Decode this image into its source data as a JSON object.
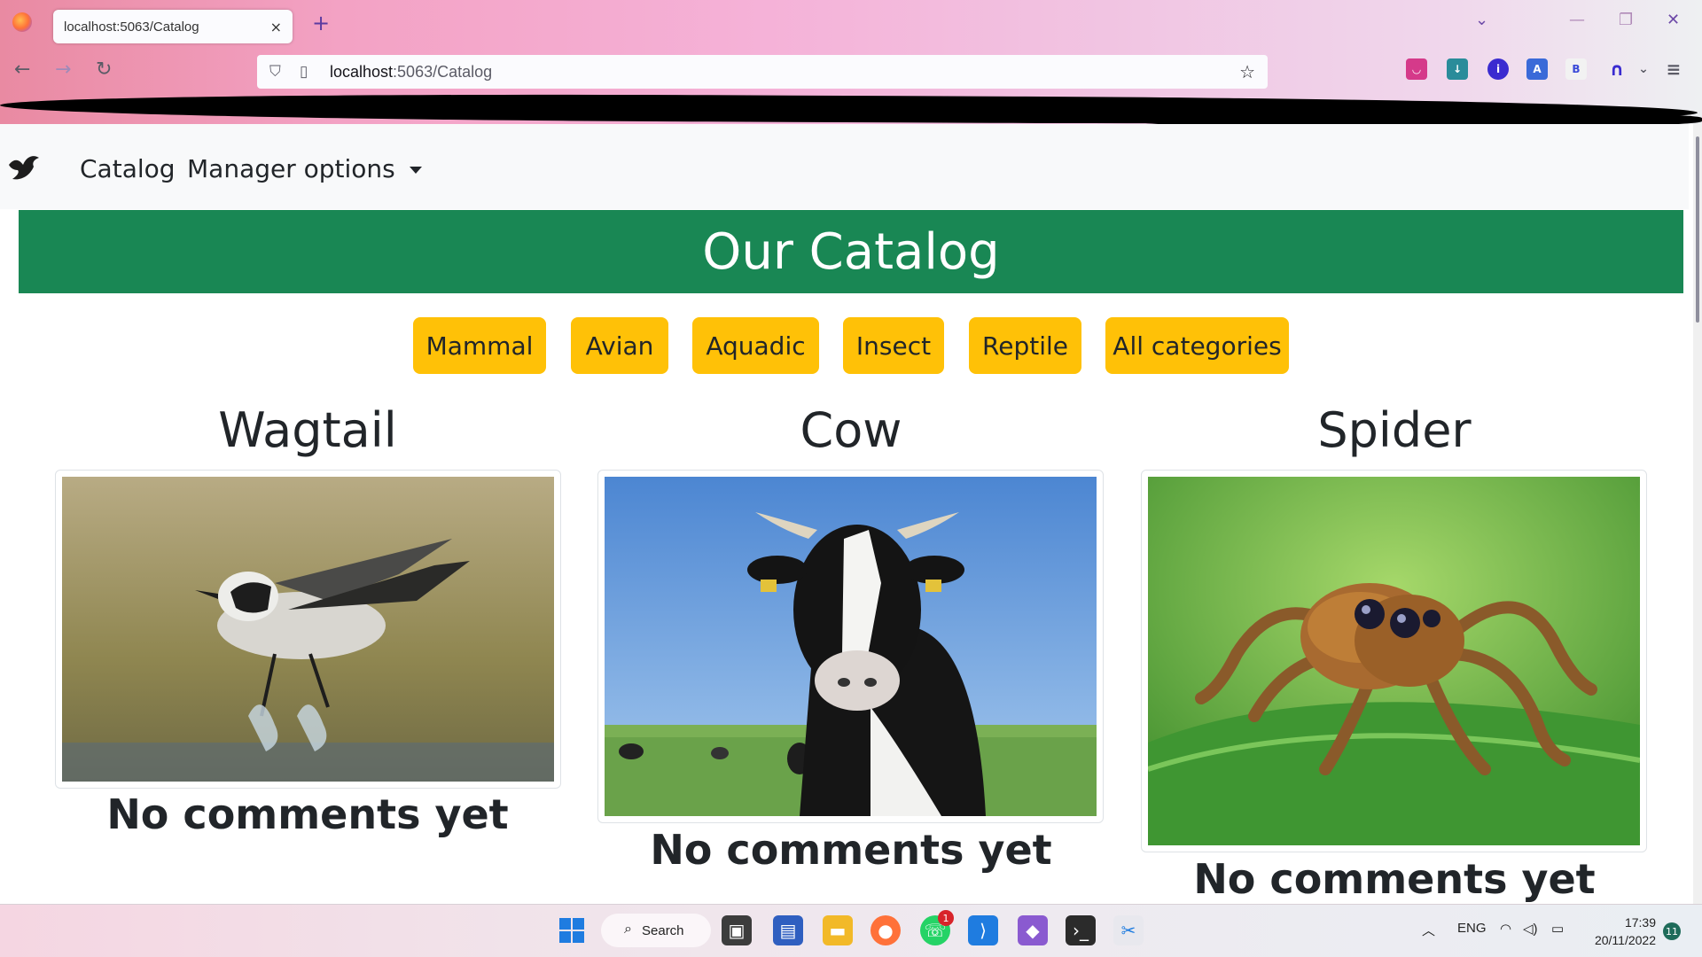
{
  "browser": {
    "tab_title": "localhost:5063/Catalog",
    "tab_close": "×",
    "new_tab": "+",
    "url_host": "localhost",
    "url_path": ":5063/Catalog",
    "extension_b_label": "B"
  },
  "navbar": {
    "catalog_label": "Catalog",
    "manager_label": "Manager options"
  },
  "hero": {
    "title": "Our Catalog"
  },
  "categories": [
    {
      "label": "Mammal"
    },
    {
      "label": "Avian"
    },
    {
      "label": "Aquadic"
    },
    {
      "label": "Insect"
    },
    {
      "label": "Reptile"
    },
    {
      "label": "All categories"
    }
  ],
  "cards": [
    {
      "name": "Wagtail",
      "comments": "No comments yet"
    },
    {
      "name": "Cow",
      "comments": "No comments yet"
    },
    {
      "name": "Spider",
      "comments": "No comments yet"
    }
  ],
  "taskbar": {
    "search_label": "Search",
    "language": "ENG",
    "time": "17:39",
    "date": "20/11/2022",
    "notification_count": "11",
    "whatsapp_badge": "1"
  },
  "colors": {
    "hero_bg": "#198754",
    "category_button": "#ffc107",
    "navbar_bg": "#f8f9fa"
  }
}
